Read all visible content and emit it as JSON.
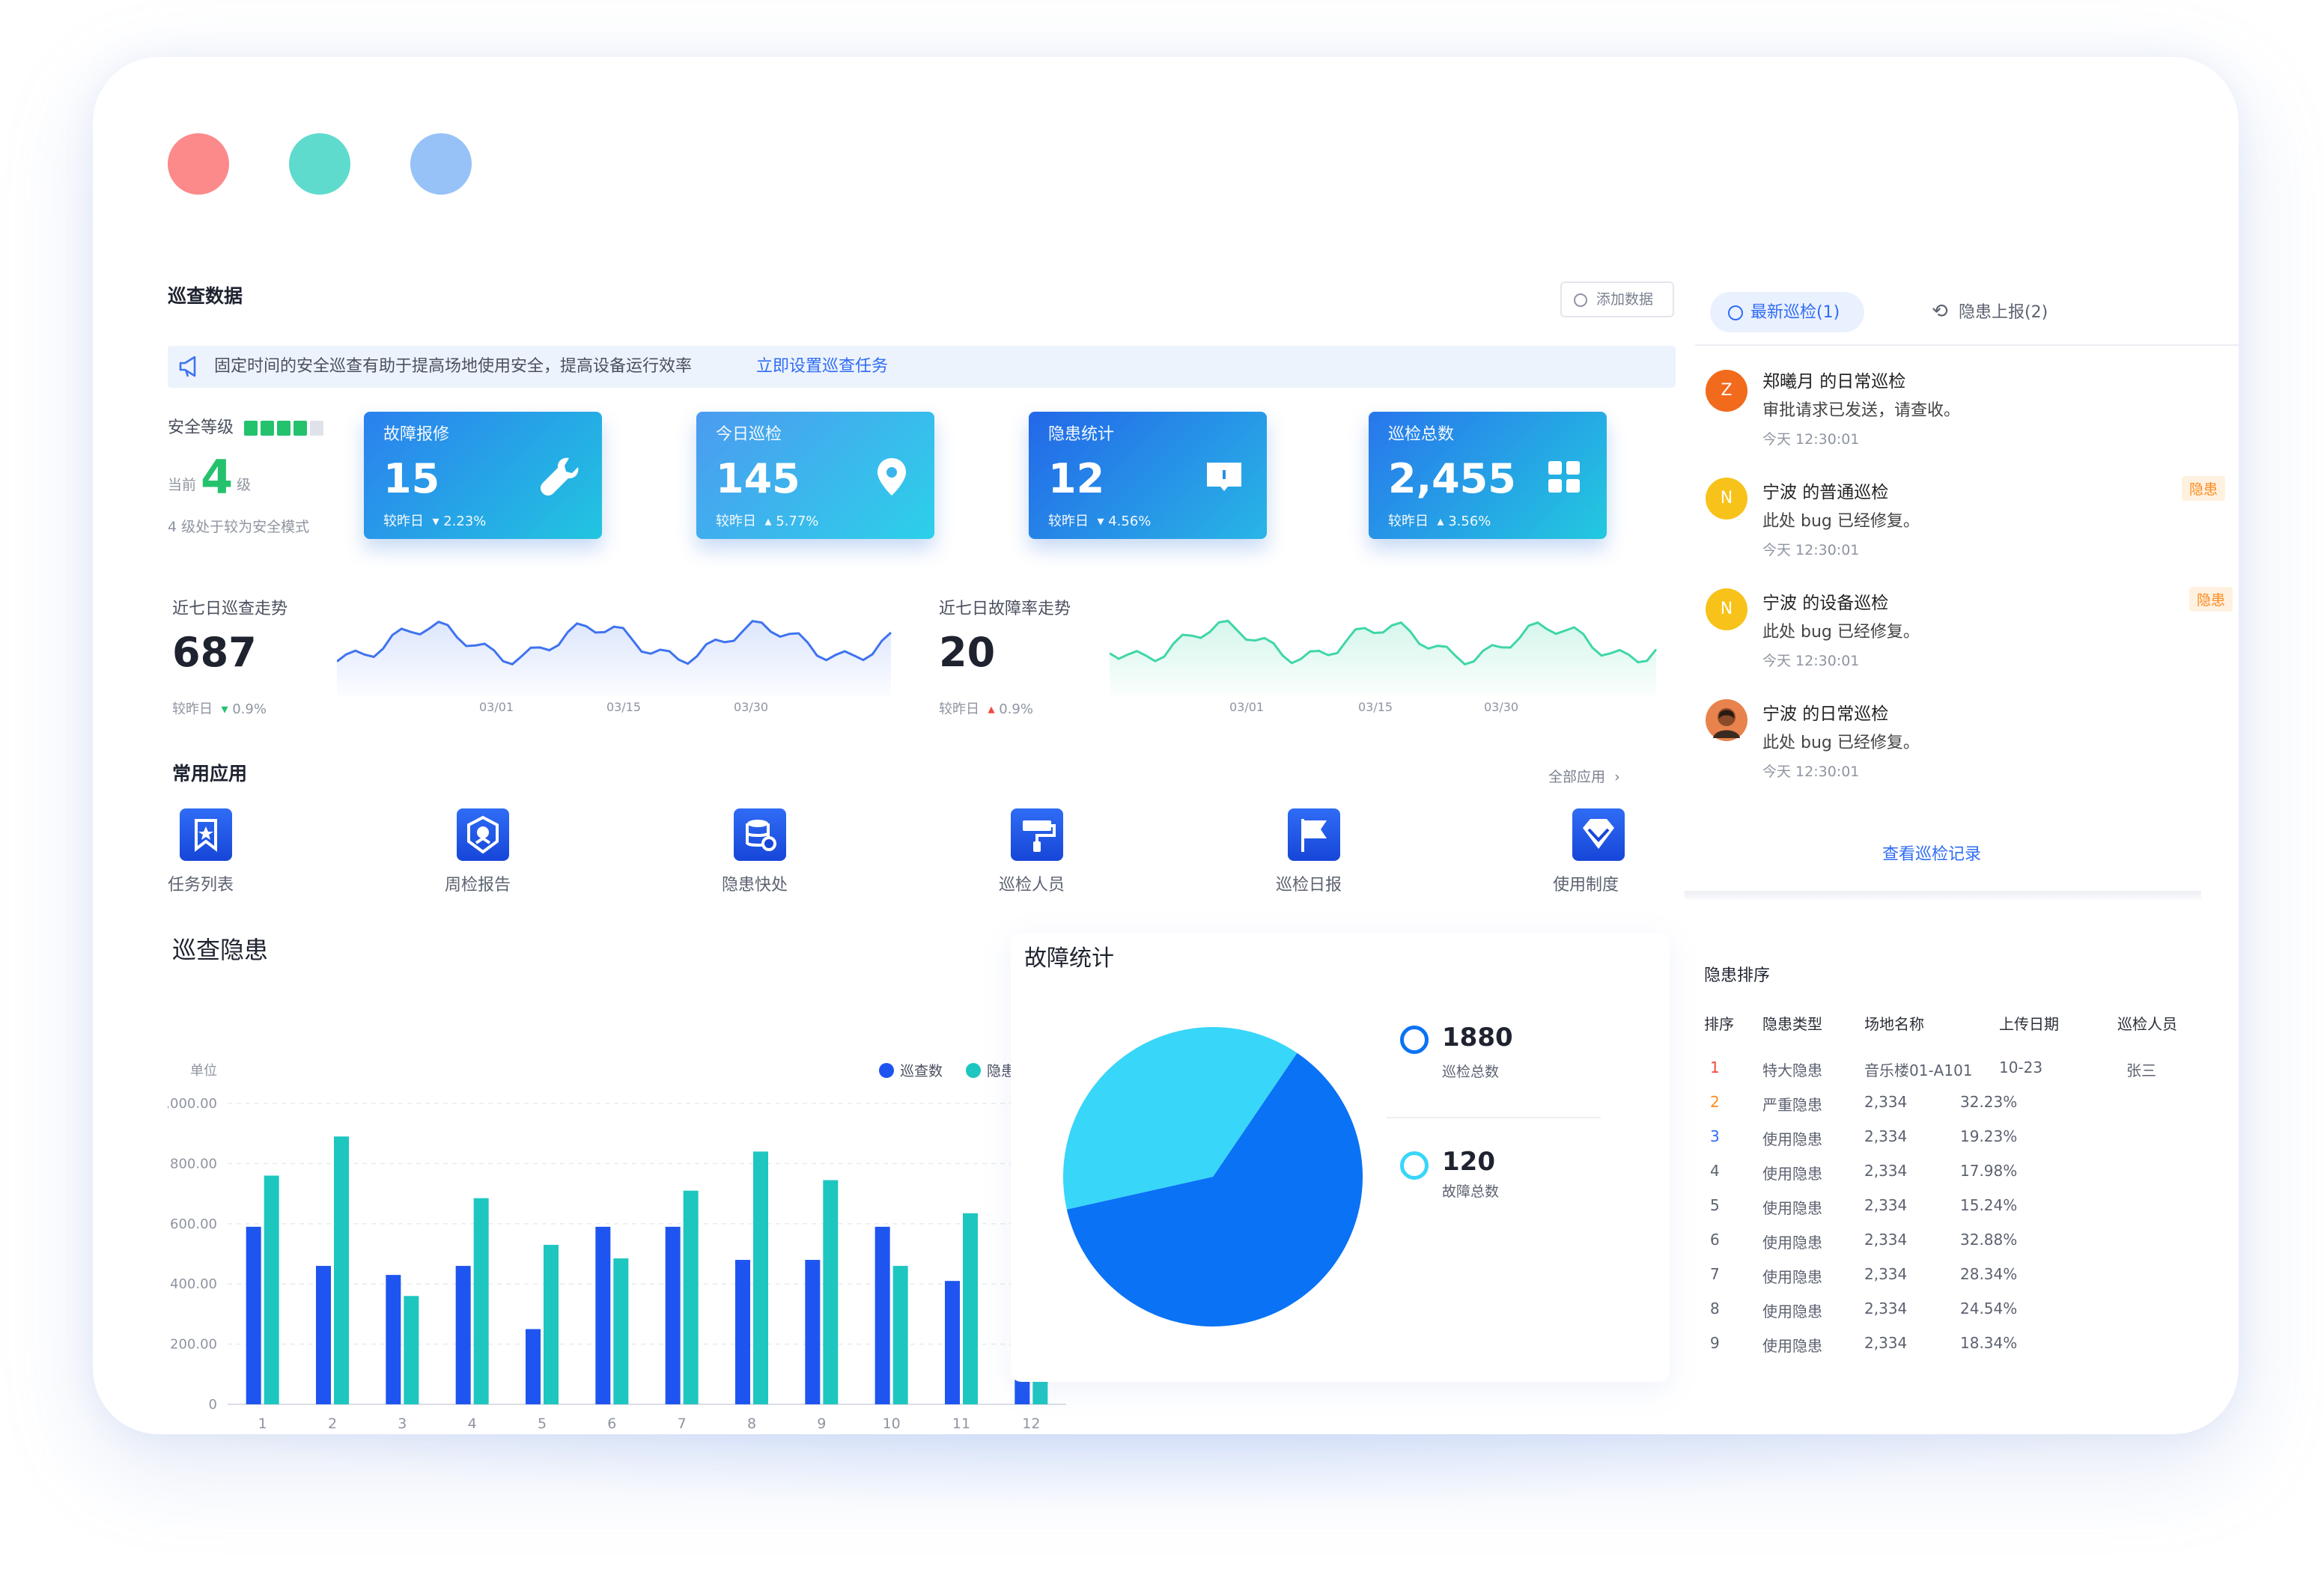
{
  "window_dots": [
    "#fc8a8a",
    "#5edbcc",
    "#97c2f8"
  ],
  "inspection": {
    "section_title": "巡查数据",
    "add_button": "添加数据",
    "notice_text": "固定时间的安全巡查有助于提高场地使用安全，提高设备运行效率",
    "notice_link": "立即设置巡查任务",
    "safety_label": "安全等级",
    "safety_prefix": "当前",
    "safety_level": "4",
    "safety_suffix": "级",
    "safety_desc": "4 级处于较为安全模式"
  },
  "stat_cards": [
    {
      "label": "故障报修",
      "value": "15",
      "compare": "较昨日",
      "change": "2.23%",
      "direction": "down",
      "icon": "wrench-icon"
    },
    {
      "label": "今日巡检",
      "value": "145",
      "compare": "较昨日",
      "change": "5.77%",
      "direction": "up",
      "icon": "location-pin-icon"
    },
    {
      "label": "隐患统计",
      "value": "12",
      "compare": "较昨日",
      "change": "4.56%",
      "direction": "down",
      "icon": "message-icon"
    },
    {
      "label": "巡检总数",
      "value": "2,455",
      "compare": "较昨日",
      "change": "3.56%",
      "direction": "up",
      "icon": "grid-icon"
    }
  ],
  "trends": [
    {
      "title": "近七日巡查走势",
      "value": "687",
      "compare": "较昨日",
      "change": "0.9%",
      "direction": "down",
      "ticks": [
        "03/01",
        "03/15",
        "03/30"
      ],
      "color": "#3f73ef"
    },
    {
      "title": "近七日故障率走势",
      "value": "20",
      "compare": "较昨日",
      "change": "0.9%",
      "direction": "up",
      "ticks": [
        "03/01",
        "03/15",
        "03/30"
      ],
      "color": "#3fd6a8"
    }
  ],
  "apps": {
    "title": "常用应用",
    "all_link": "全部应用",
    "items": [
      {
        "label": "任务列表",
        "icon": "bookmark-icon"
      },
      {
        "label": "周检报告",
        "icon": "badge-icon"
      },
      {
        "label": "隐患快处",
        "icon": "database-icon"
      },
      {
        "label": "巡检人员",
        "icon": "paint-roller-icon"
      },
      {
        "label": "巡检日报",
        "icon": "flag-icon"
      },
      {
        "label": "使用制度",
        "icon": "diamond-icon"
      }
    ]
  },
  "hazard_chart_title": "巡查隐患",
  "fault_chart_title": "故障统计",
  "chart_data": [
    {
      "type": "bar",
      "ylabel": "单位",
      "ylim": [
        0,
        1000
      ],
      "yticks": [
        "0",
        "200.00",
        "400.00",
        "600.00",
        "800.00",
        "1,000.00"
      ],
      "categories": [
        "1",
        "2",
        "3",
        "4",
        "5",
        "6",
        "7",
        "8",
        "9",
        "10",
        "11",
        "12"
      ],
      "legend": "top-right",
      "grid": true,
      "series": [
        {
          "name": "巡查数",
          "color": "#1e55f0",
          "values": [
            590,
            460,
            430,
            460,
            250,
            590,
            590,
            480,
            480,
            590,
            410,
            405
          ]
        },
        {
          "name": "隐患数",
          "color": "#1ec6c0",
          "values": [
            760,
            890,
            360,
            685,
            530,
            485,
            710,
            840,
            745,
            460,
            635,
            635
          ]
        }
      ]
    },
    {
      "type": "pie",
      "slices": [
        {
          "label": "巡检总数",
          "value": 1880,
          "color": "#0a72f5"
        },
        {
          "label": "故障总数",
          "value": 120,
          "color": "#38d6f9"
        }
      ]
    }
  ],
  "pie_legend": [
    {
      "value": "1880",
      "label": "巡检总数",
      "color": "#0a72f5"
    },
    {
      "value": "120",
      "label": "故障总数",
      "color": "#38d6f9"
    }
  ],
  "feed": {
    "tab_active": "最新巡检(1)",
    "tab_other": "隐患上报(2)",
    "items": [
      {
        "avatar": "Z",
        "title": "郑曦月 的日常巡检",
        "desc": "审批请求已发送，请查收。",
        "time": "今天 12:30:01",
        "tag": "",
        "color": "#f26a1b"
      },
      {
        "avatar": "N",
        "title": "宁波 的普通巡检",
        "desc": "此处 bug 已经修复。",
        "time": "今天 12:30:01",
        "tag": "隐患",
        "color": "#f7c21a"
      },
      {
        "avatar": "N",
        "title": "宁波 的设备巡检",
        "desc": "此处 bug 已经修复。",
        "time": "今天 12:30:01",
        "tag": "隐患",
        "color": "#f7c21a"
      },
      {
        "avatar": "",
        "title": "宁波 的日常巡检",
        "desc": "此处 bug 已经修复。",
        "time": "今天 12:30:01",
        "tag": "",
        "color": "#e8834d"
      }
    ],
    "view_all": "查看巡检记录"
  },
  "ranking": {
    "title": "隐患排序",
    "headers": [
      "排序",
      "隐患类型",
      "场地名称",
      "上传日期",
      "巡检人员"
    ],
    "rows": [
      {
        "rank": "1",
        "type": "特大隐患",
        "place": "音乐楼01-A101",
        "date": "10-23",
        "person": "张三",
        "color": "#f5463c"
      },
      {
        "rank": "2",
        "type": "严重隐患",
        "place": "2,334",
        "date": "32.23%",
        "person": "",
        "color": "#ff8a1f"
      },
      {
        "rank": "3",
        "type": "使用隐患",
        "place": "2,334",
        "date": "19.23%",
        "person": "",
        "color": "#2f6cf5"
      },
      {
        "rank": "4",
        "type": "使用隐患",
        "place": "2,334",
        "date": "17.98%",
        "person": "",
        "color": "#5c6270"
      },
      {
        "rank": "5",
        "type": "使用隐患",
        "place": "2,334",
        "date": "15.24%",
        "person": "",
        "color": "#5c6270"
      },
      {
        "rank": "6",
        "type": "使用隐患",
        "place": "2,334",
        "date": "32.88%",
        "person": "",
        "color": "#5c6270"
      },
      {
        "rank": "7",
        "type": "使用隐患",
        "place": "2,334",
        "date": "28.34%",
        "person": "",
        "color": "#5c6270"
      },
      {
        "rank": "8",
        "type": "使用隐患",
        "place": "2,334",
        "date": "24.54%",
        "person": "",
        "color": "#5c6270"
      },
      {
        "rank": "9",
        "type": "使用隐患",
        "place": "2,334",
        "date": "18.34%",
        "person": "",
        "color": "#5c6270"
      }
    ]
  }
}
